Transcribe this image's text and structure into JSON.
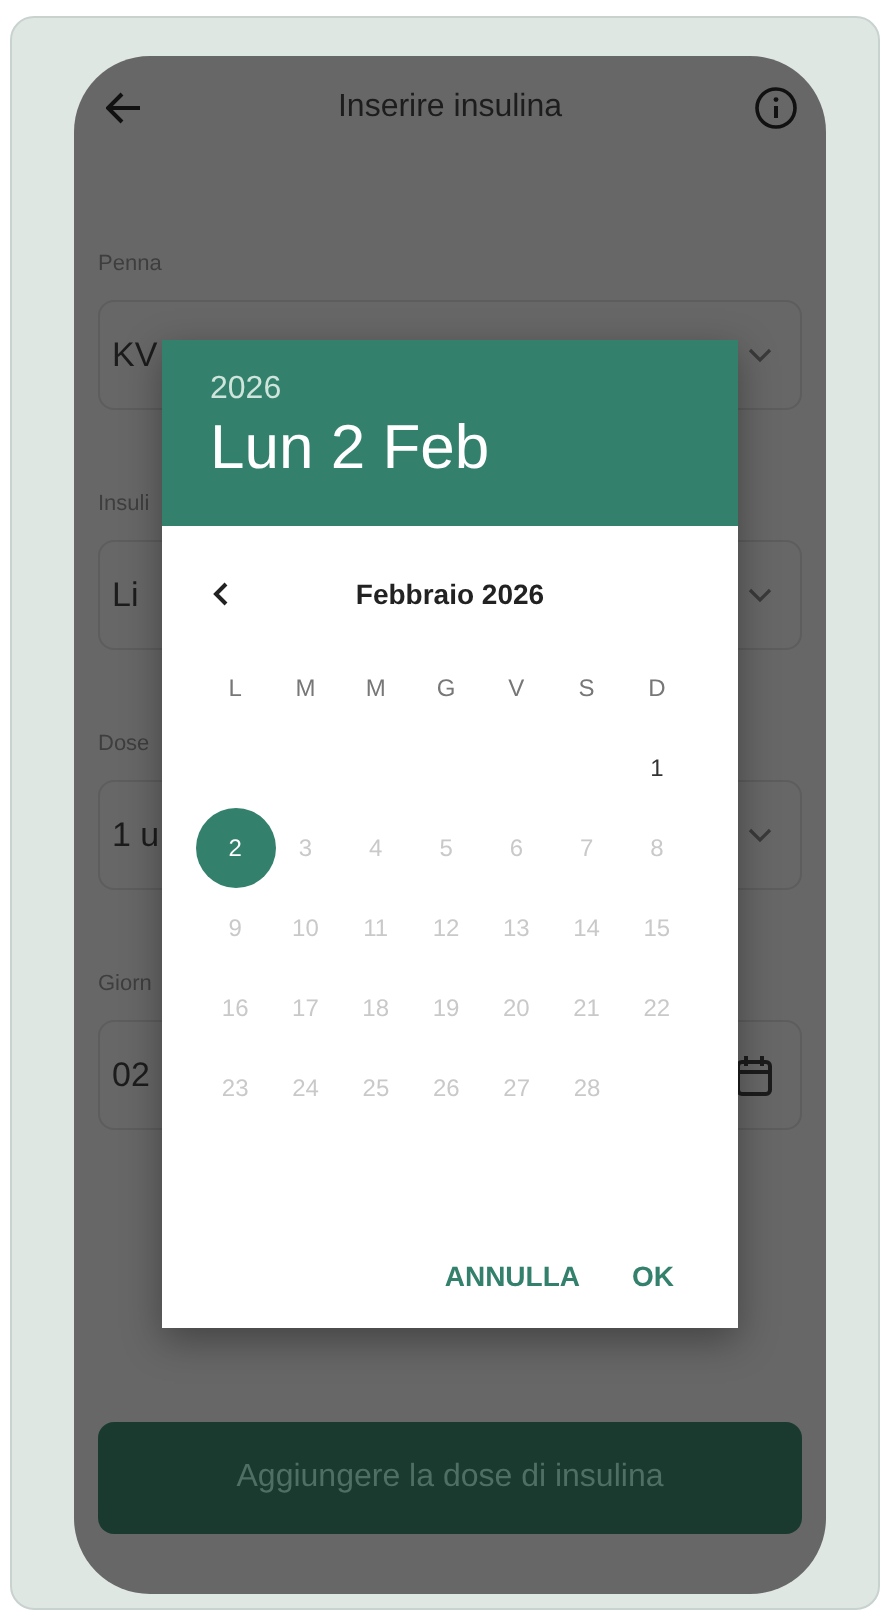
{
  "app_bar": {
    "title": "Inserire insulina"
  },
  "fields": [
    {
      "label": "Penna",
      "value": "KV",
      "kind": "select"
    },
    {
      "label": "Insuli",
      "value": "Li",
      "kind": "select"
    },
    {
      "label": "Dose",
      "value": "1 u",
      "kind": "select"
    },
    {
      "label": "Giorn",
      "value": "02",
      "kind": "date"
    }
  ],
  "submit_button": {
    "label": "Aggiungere la dose di insulina",
    "disabled": true
  },
  "date_dialog": {
    "year": "2026",
    "date": "Lun 2 Feb",
    "month_label": "Febbraio 2026",
    "weekdays": [
      "L",
      "M",
      "M",
      "G",
      "V",
      "S",
      "D"
    ],
    "weeks": [
      [
        {
          "label": "1",
          "selected": false,
          "disabled": false
        }
      ],
      [
        {
          "label": "2",
          "selected": true,
          "disabled": false
        },
        {
          "label": "3",
          "selected": false,
          "disabled": true
        },
        {
          "label": "4",
          "selected": false,
          "disabled": true
        },
        {
          "label": "5",
          "selected": false,
          "disabled": true
        },
        {
          "label": "6",
          "selected": false,
          "disabled": true
        },
        {
          "label": "7",
          "selected": false,
          "disabled": true
        },
        {
          "label": "8",
          "selected": false,
          "disabled": true
        }
      ],
      [
        {
          "label": "9",
          "selected": false,
          "disabled": true
        },
        {
          "label": "10",
          "selected": false,
          "disabled": true
        },
        {
          "label": "11",
          "selected": false,
          "disabled": true
        },
        {
          "label": "12",
          "selected": false,
          "disabled": true
        },
        {
          "label": "13",
          "selected": false,
          "disabled": true
        },
        {
          "label": "14",
          "selected": false,
          "disabled": true
        },
        {
          "label": "15",
          "selected": false,
          "disabled": true
        }
      ],
      [
        {
          "label": "16",
          "selected": false,
          "disabled": true
        },
        {
          "label": "17",
          "selected": false,
          "disabled": true
        },
        {
          "label": "18",
          "selected": false,
          "disabled": true
        },
        {
          "label": "19",
          "selected": false,
          "disabled": true
        },
        {
          "label": "20",
          "selected": false,
          "disabled": true
        },
        {
          "label": "21",
          "selected": false,
          "disabled": true
        },
        {
          "label": "22",
          "selected": false,
          "disabled": true
        }
      ],
      [
        {
          "label": "23",
          "selected": false,
          "disabled": true
        },
        {
          "label": "24",
          "selected": false,
          "disabled": true
        },
        {
          "label": "25",
          "selected": false,
          "disabled": true
        },
        {
          "label": "26",
          "selected": false,
          "disabled": true
        },
        {
          "label": "27",
          "selected": false,
          "disabled": true
        },
        {
          "label": "28",
          "selected": false,
          "disabled": true
        }
      ]
    ],
    "buttons": [
      "ANNULLA",
      "OK"
    ]
  }
}
